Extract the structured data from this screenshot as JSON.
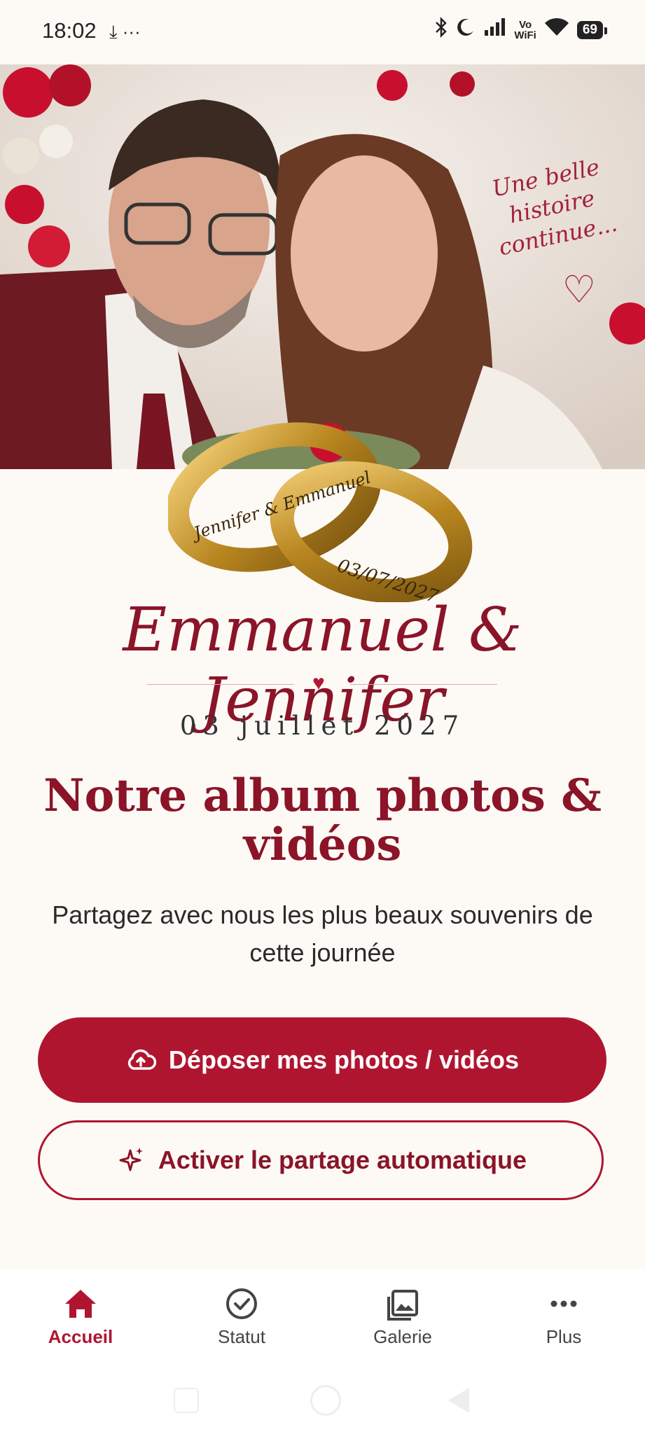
{
  "status_bar": {
    "time": "18:02",
    "left_icons": "⤓ ···",
    "vowifi": "Vo\nWiFi",
    "battery": "69"
  },
  "hero": {
    "caption": "Une belle histoire continue...",
    "rings_text_1": "Jennifer & Emmanuel",
    "rings_text_2": "03/07/2027"
  },
  "couple": {
    "names": "Emmanuel & Jennifer",
    "date": "03 juillet 2027"
  },
  "main": {
    "headline": "Notre album photos & vidéos",
    "subtitle": "Partagez avec nous les plus beaux souvenirs de cette journée",
    "upload_label": "Déposer mes photos / vidéos",
    "auto_share_label": "Activer le partage automatique"
  },
  "nav": [
    {
      "label": "Accueil",
      "icon": "home-icon",
      "active": true
    },
    {
      "label": "Statut",
      "icon": "check-circle-icon",
      "active": false
    },
    {
      "label": "Galerie",
      "icon": "gallery-icon",
      "active": false
    },
    {
      "label": "Plus",
      "icon": "more-icon",
      "active": false
    }
  ],
  "colors": {
    "accent": "#b01530",
    "title": "#8b1428",
    "background": "#fdfaf6"
  }
}
